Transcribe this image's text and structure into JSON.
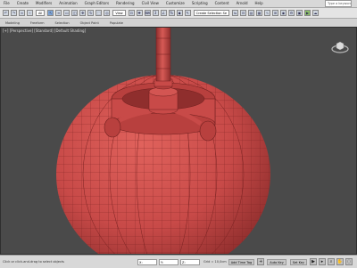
{
  "menu": {
    "items": [
      "File",
      "Create",
      "Modifiers",
      "Animation",
      "Graph Editors",
      "Rendering",
      "Civil View",
      "Customize",
      "Scripting",
      "Content",
      "Arnold",
      "Help"
    ],
    "search_placeholder": "Type a keyword or phrase"
  },
  "toolbar": {
    "undo_icon": "undo-icon",
    "redo_icon": "redo-icon",
    "selection_filter": "All",
    "view_dropdown": "View",
    "named_selection": "Create Selection Se"
  },
  "ribbon": {
    "tabs": [
      "Modeling",
      "Freeform",
      "Selection",
      "Object Paint",
      "Populate"
    ]
  },
  "viewport": {
    "label": "[+] [Perspective] [Standard] [Default Shading]",
    "model_color": "#c84a48",
    "background_color": "#4a4a4a"
  },
  "status": {
    "prompt": "Click or click-and-drag to select objects",
    "x": "X:",
    "y": "Y:",
    "z": "Z:",
    "grid": "Grid = 10,0cm",
    "add_time_tag": "Add Time Tag",
    "auto_key": "Auto Key",
    "set_key": "Set Key",
    "selected": "Selected"
  }
}
